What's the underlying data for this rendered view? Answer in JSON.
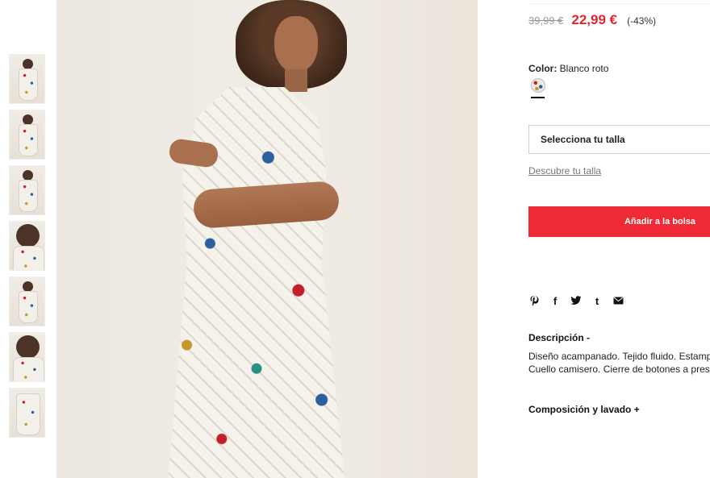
{
  "product": {
    "old_price": "39,99 €",
    "new_price": "22,99 €",
    "discount": "(-43%)",
    "color_label": "Color:",
    "color_name": "Blanco roto",
    "size_placeholder": "Selecciona tu talla",
    "size_guide": "Descubre tu talla",
    "add_to_bag": "Añadir a la bolsa",
    "description_title": "Descripción -",
    "description_lines": [
      "Diseño acampanado. Tejido fluido. Estampado",
      "Cuello camisero. Cierre de botones a presión"
    ],
    "composition_title": "Composición y lavado +"
  },
  "share": {
    "pinterest": "p",
    "facebook": "f",
    "twitter": "t",
    "tumblr": "t",
    "email": "✉"
  },
  "colors": {
    "sale": "#e2242e",
    "button": "#ee2a36"
  },
  "gallery": {
    "thumbnail_count": 7,
    "active_thumbnail": 1
  }
}
